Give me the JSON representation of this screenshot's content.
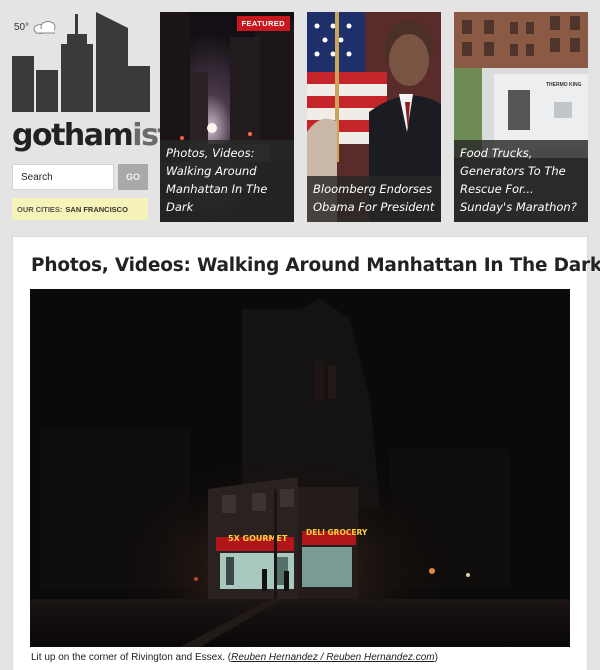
{
  "weather": {
    "temperature": "50°",
    "icon": "cloud-icon"
  },
  "brand": {
    "logo_text_main": "gotham",
    "logo_text_accent": "ist"
  },
  "search": {
    "value": "Search",
    "button_label": "GO"
  },
  "cities": {
    "label": "OUR CITIES:",
    "city": "SAN FRANCISCO"
  },
  "tiles": [
    {
      "badge": "FEATURED",
      "caption": "Photos, Videos: Walking Around Manhattan In The Dark"
    },
    {
      "caption": "Bloomberg Endorses Obama For President"
    },
    {
      "caption": "Food Trucks, Generators To The Rescue For... Sunday's Marathon?",
      "truck_brand": "THERMO KING"
    }
  ],
  "article": {
    "title": "Photos, Videos: Walking Around Manhattan In The Dark",
    "photo_signs": [
      "5X GOURMET",
      "DELI GROCERY"
    ],
    "caption_text": "Lit up on the corner of Rivington and Essex. (",
    "caption_credit": "Reuben Hernandez / Reuben Hernandez.com",
    "caption_end": ")"
  },
  "colors": {
    "background": "#e4e4e4",
    "badge": "#c8171e",
    "cities_bg": "#f6f3b9",
    "logo": "#3a3a3a"
  }
}
